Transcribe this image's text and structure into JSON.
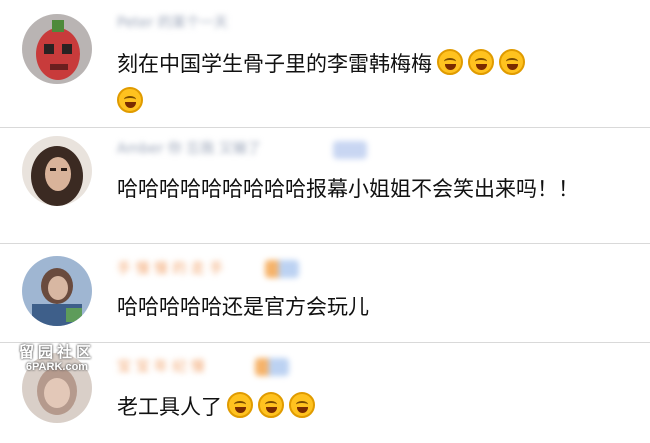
{
  "comments": [
    {
      "username": "Peter 的某个一天",
      "text": "刻在中国学生骨子里的李雷韩梅梅",
      "emojis": [
        "laugh-cry-emoji",
        "laugh-cry-emoji",
        "laugh-cry-emoji",
        "laugh-cry-emoji"
      ]
    },
    {
      "username": "Amber 你 忘我 又输了",
      "text": "哈哈哈哈哈哈哈哈哈报幕小姐姐不会笑出来吗！！",
      "emojis": []
    },
    {
      "username": "手 慢 慢 的 走 手",
      "text": "哈哈哈哈哈还是官方会玩儿",
      "emojis": []
    },
    {
      "username": "宝 宝 年 纪 慢",
      "text": "老工具人了",
      "emojis": [
        "laugh-cry-emoji",
        "laugh-cry-emoji",
        "laugh-cry-emoji"
      ]
    }
  ],
  "watermark": {
    "line1": "留园社区",
    "line2": "6PARK.com"
  }
}
